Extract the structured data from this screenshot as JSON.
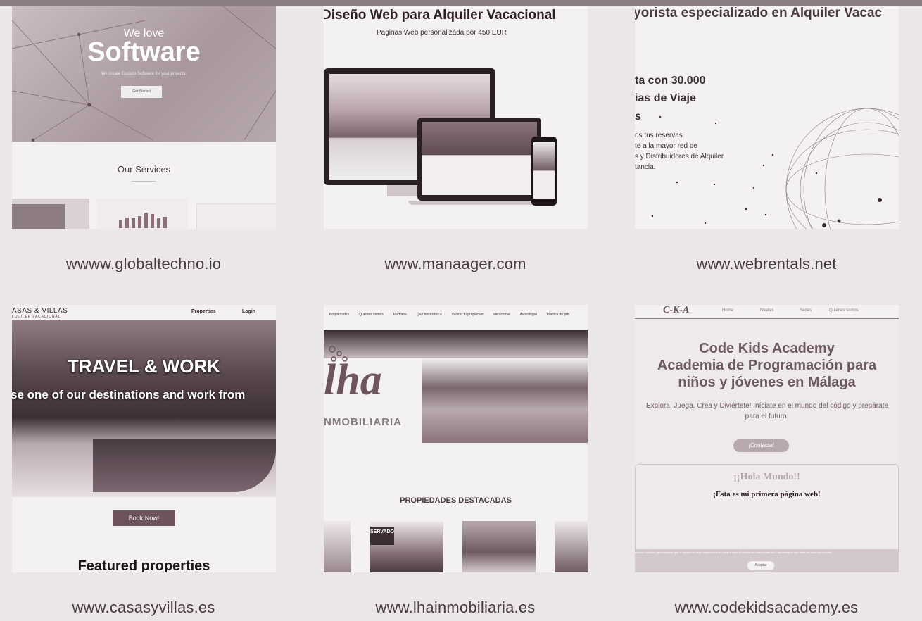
{
  "colors": {
    "background": "#ebe7e8",
    "caption": "#4a3a41",
    "accent": "#6e545d"
  },
  "sites": [
    {
      "url": "wwww.globaltechno.io",
      "hero_small": "We love",
      "hero_big": "Software",
      "hero_sub": "We create Custom Software for your projects.",
      "cta": "Get Started",
      "section": "Our Services"
    },
    {
      "url": "www.manaager.com",
      "title": "Diseño Web para Alquiler Vacacional",
      "subtitle": "Paginas Web personalizada por 450 EUR"
    },
    {
      "url": "www.webrentals.net",
      "title": "yorista especializado en Alquiler Vacac",
      "line1": "ta con 30.000",
      "line2": "ias de Viaje",
      "line3": "s",
      "body1": "os tus reservas",
      "body2": "te a la mayor red de",
      "body3": "s y Distribuidores de Alquiler",
      "body4": "tancia."
    },
    {
      "url": "www.casasyvillas.es",
      "logo": "ASAS & VILLAS",
      "logo_sub": "LQUILER VACACIONAL",
      "nav": [
        "Properties",
        "Login"
      ],
      "hero": "TRAVEL & WORK",
      "hero_sub": "se one of our destinations and work from",
      "cta": "Book Now!",
      "section": "Featured properties"
    },
    {
      "url": "www.lhainmobiliaria.es",
      "nav": [
        "Propiedades",
        "Quiénes somos",
        "Partners",
        "Qué necesitas ▾",
        "Valorar tu propiedad",
        "Vacacional",
        "Aviso legal",
        "Política de priv"
      ],
      "logo": "lha",
      "logo_sub": "NMOBILIARIA",
      "section": "PROPIEDADES DESTACADAS",
      "badge": "SERVADO"
    },
    {
      "url": "www.codekidsacademy.es",
      "logo": "C-K-A",
      "nav": [
        "Home",
        "Niveles",
        "Sedes",
        "Quienes somos"
      ],
      "title1": "Code Kids Academy",
      "title2": "Academia de Programación para",
      "title3": "niños y jóvenes en Málaga",
      "body": "Explora, Juega, Crea y Diviértete! Iníciate en el mundo del código y prepárate",
      "body2": "para el futuro.",
      "cta": "¡Contacta!",
      "hello": "¡¡Hola Mundo!!",
      "hello_sub": "¡Esta es mi primera página web!",
      "cookie": "usamos cookies para asegurar que te damos la mejor experiencia en nuestra web. Si continúas usando este sitio, asumiremos que estás de acuerdo con ello.",
      "cookie_btn": "Aceptar"
    }
  ]
}
